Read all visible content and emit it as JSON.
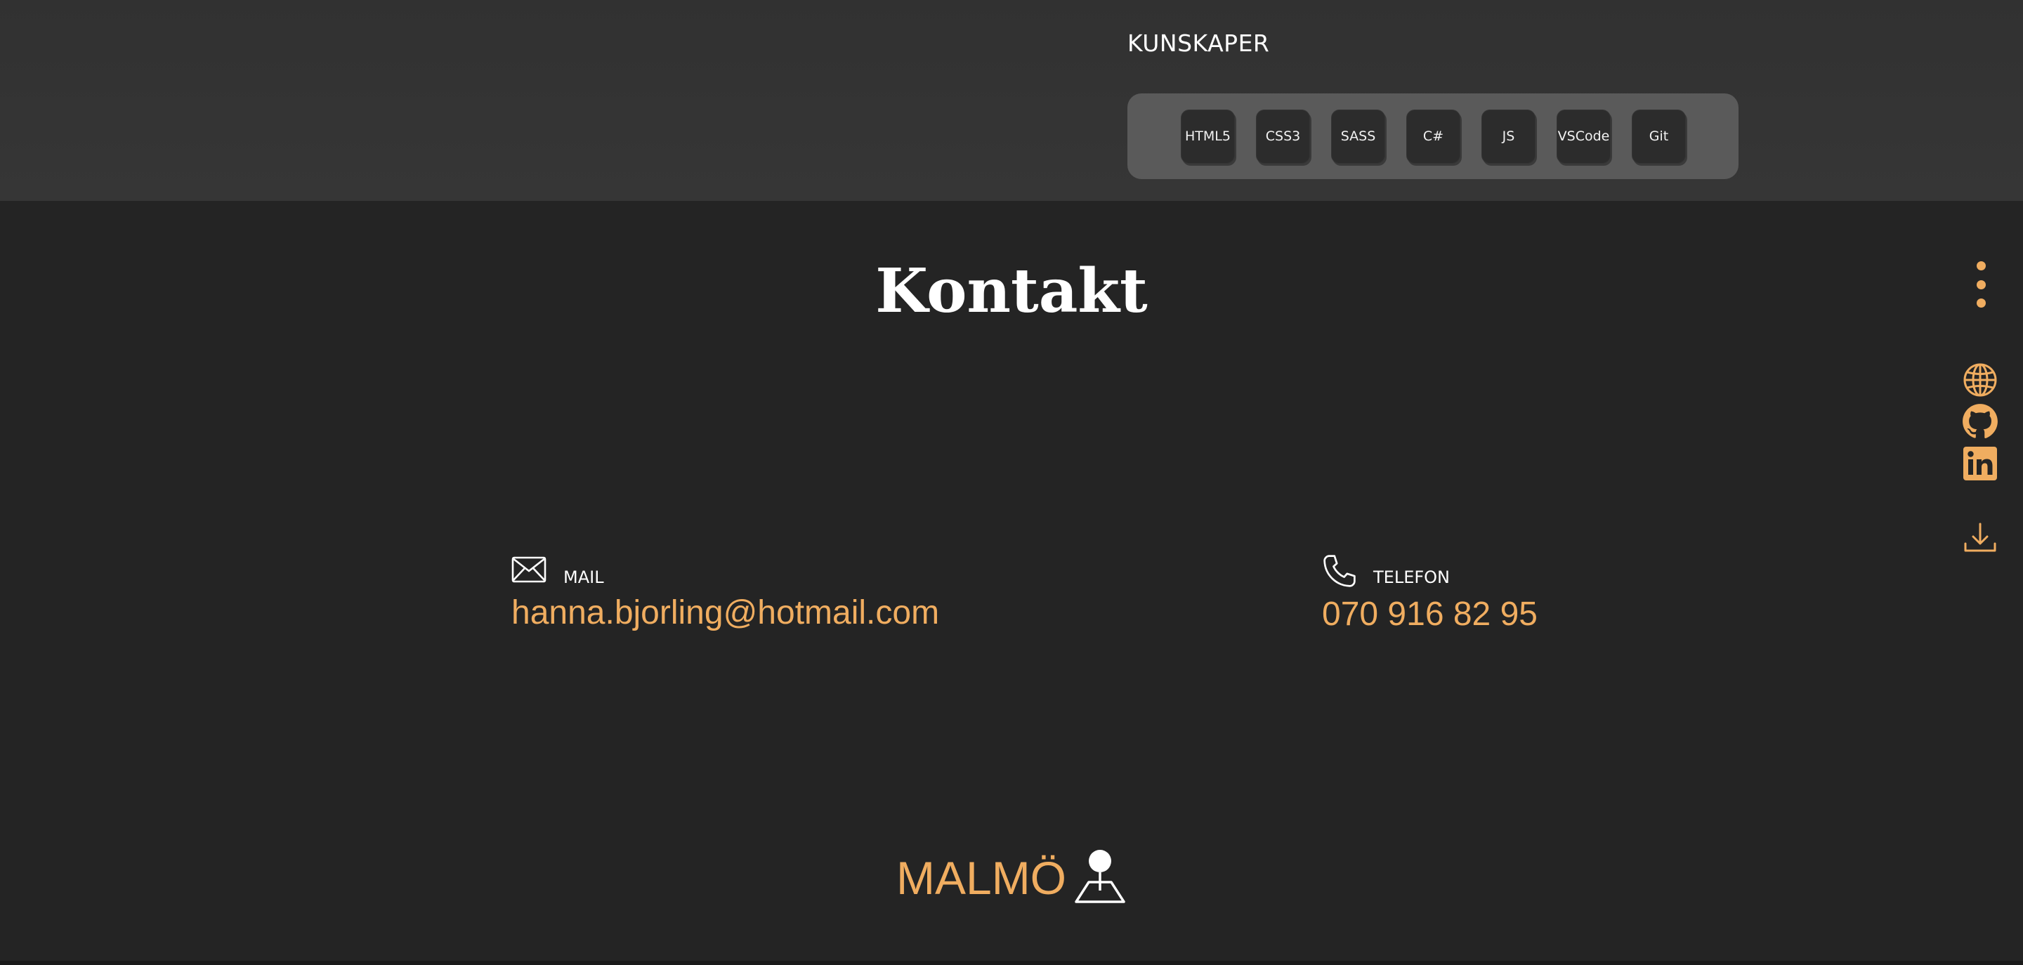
{
  "skills": {
    "heading": "KUNSKAPER",
    "items": [
      "HTML5",
      "CSS3",
      "SASS",
      "C#",
      "JS",
      "VSCode",
      "Git"
    ]
  },
  "contact": {
    "title": "Kontakt",
    "mail": {
      "label": "MAIL",
      "value": "hanna.bjorling@hotmail.com",
      "icon": "envelope-icon"
    },
    "phone": {
      "label": "TELEFON",
      "value": "070 916 82 95",
      "icon": "phone-icon"
    },
    "location": {
      "city": "MALMÖ",
      "icon": "map-pin-icon"
    }
  },
  "side_rail": {
    "menu_icon": "kebab-menu-icon",
    "links": [
      "globe-icon",
      "github-icon",
      "linkedin-icon"
    ],
    "download_icon": "download-icon"
  },
  "colors": {
    "background": "#242424",
    "skills_band": "#353535",
    "skills_panel": "#5a5a5a",
    "chip": "#2c2c2c",
    "accent": "#f0ad60",
    "text": "#ffffff"
  }
}
